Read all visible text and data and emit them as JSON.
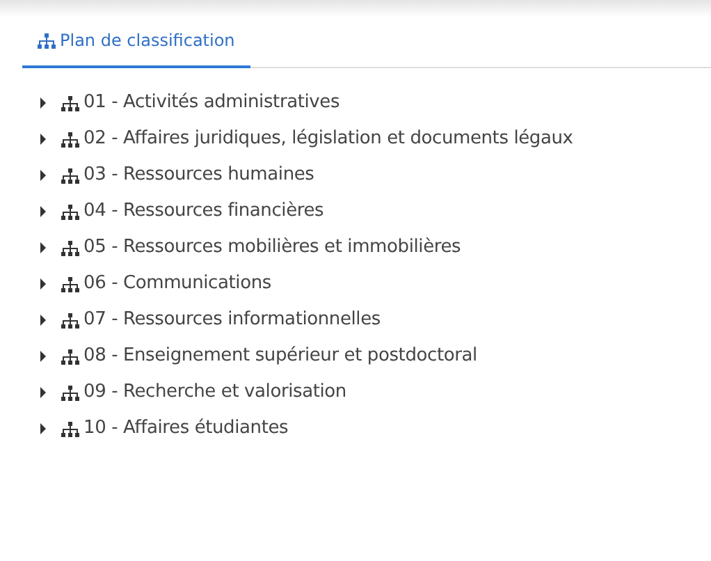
{
  "tabs": [
    {
      "label": "Plan de classification",
      "selected": true
    }
  ],
  "tree": [
    {
      "label": "01 - Activités administratives",
      "expanded": false
    },
    {
      "label": "02 - Affaires juridiques, législation et documents légaux",
      "expanded": false
    },
    {
      "label": "03 - Ressources humaines",
      "expanded": false
    },
    {
      "label": "04 - Ressources financières",
      "expanded": false
    },
    {
      "label": "05 - Ressources mobilières et immobilières",
      "expanded": false
    },
    {
      "label": "06 - Communications",
      "expanded": false
    },
    {
      "label": "07 - Ressources informationnelles",
      "expanded": false
    },
    {
      "label": "08 - Enseignement supérieur et postdoctoral",
      "expanded": false
    },
    {
      "label": "09 - Recherche et valorisation",
      "expanded": false
    },
    {
      "label": "10 - Affaires étudiantes",
      "expanded": false
    }
  ]
}
